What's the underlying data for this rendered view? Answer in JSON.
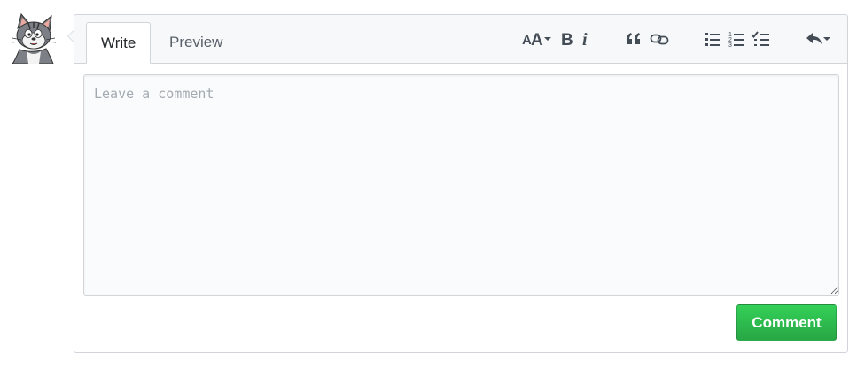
{
  "avatar": {
    "icon": "cat-avatar-icon"
  },
  "tabs": [
    {
      "label": "Write"
    },
    {
      "label": "Preview"
    }
  ],
  "toolbar": {
    "icons": [
      "text-size-icon",
      "bold-icon",
      "italic-icon",
      "quote-icon",
      "link-icon",
      "unordered-list-icon",
      "ordered-list-icon",
      "task-list-icon",
      "reply-icon"
    ]
  },
  "comment_field": {
    "placeholder": "Leave a comment",
    "value": ""
  },
  "actions": {
    "comment_label": "Comment"
  },
  "colors": {
    "accent_green": "#28a745",
    "border": "#d1d5da",
    "header_bg": "#f6f8fa"
  }
}
